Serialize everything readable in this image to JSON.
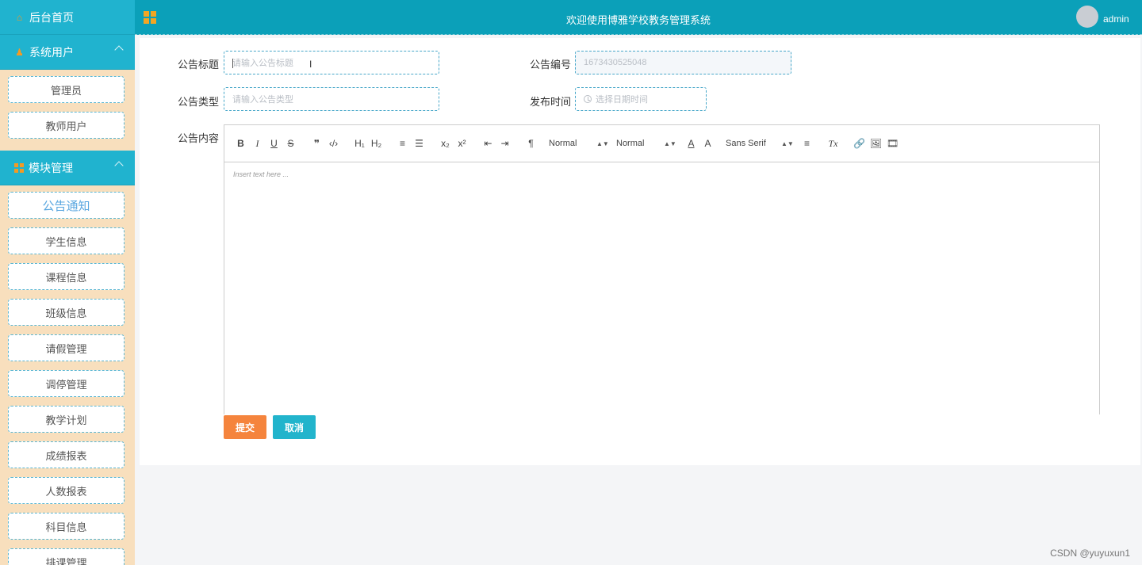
{
  "sidebar": {
    "home_label": "后台首页",
    "groups": [
      {
        "label": "系统用户",
        "items": [
          {
            "label": "管理员"
          },
          {
            "label": "教师用户"
          }
        ]
      },
      {
        "label": "模块管理",
        "items": [
          {
            "label": "公告通知"
          },
          {
            "label": "学生信息"
          },
          {
            "label": "课程信息"
          },
          {
            "label": "班级信息"
          },
          {
            "label": "请假管理"
          },
          {
            "label": "调停管理"
          },
          {
            "label": "教学计划"
          },
          {
            "label": "成绩报表"
          },
          {
            "label": "人数报表"
          },
          {
            "label": "科目信息"
          },
          {
            "label": "排课管理"
          }
        ]
      }
    ]
  },
  "topbar": {
    "title": "欢迎使用博雅学校教务管理系统",
    "user": "admin"
  },
  "form": {
    "title_label": "公告标题",
    "title_placeholder": "请输入公告标题",
    "number_label": "公告编号",
    "number_value": "1673430525048",
    "type_label": "公告类型",
    "type_placeholder": "请输入公告类型",
    "time_label": "发布时间",
    "time_placeholder": "选择日期时间",
    "content_label": "公告内容",
    "editor_placeholder": "Insert text here ...",
    "toolbar": {
      "bold": "B",
      "italic": "I",
      "underline": "U",
      "strike": "S",
      "quote": "❞",
      "code": "‹/›",
      "h1": "H₁",
      "h2": "H₂",
      "ordered": "≡",
      "bullet": "☰",
      "sub": "x₂",
      "sup": "x²",
      "outdent": "⇤",
      "indent": "⇥",
      "direction": "¶",
      "size": "Normal",
      "header": "Normal",
      "font": "Sans Serif",
      "color": "A",
      "background": "A",
      "align": "≡",
      "clean": "Tx",
      "link": "🔗",
      "image": "🖼",
      "video": "🎞"
    },
    "submit": "提交",
    "cancel": "取消"
  },
  "watermark": "CSDN @yuyuxun1",
  "colors": {
    "sidebar_head": "#20b3cf",
    "topbar": "#0ba0b9",
    "submit": "#f5843d",
    "cancel": "#22b4cc",
    "sidebar_bg": "#f8dfbd"
  }
}
